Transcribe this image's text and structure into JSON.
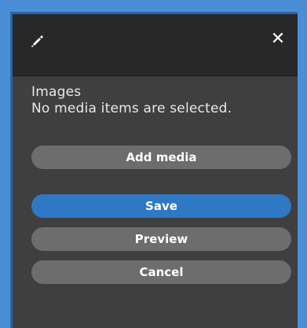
{
  "header": {
    "edit_icon": "pencil-icon",
    "close_icon": "close-icon",
    "close_glyph": "✕"
  },
  "field": {
    "title": "Images",
    "description": "No media items are selected."
  },
  "buttons": {
    "add_media": "Add media",
    "save": "Save",
    "preview": "Preview",
    "cancel": "Cancel"
  },
  "colors": {
    "primary": "#2f78c4",
    "secondary": "#6d6d6d",
    "panel_bg": "#3f3f3f",
    "header_bg": "#282828"
  }
}
